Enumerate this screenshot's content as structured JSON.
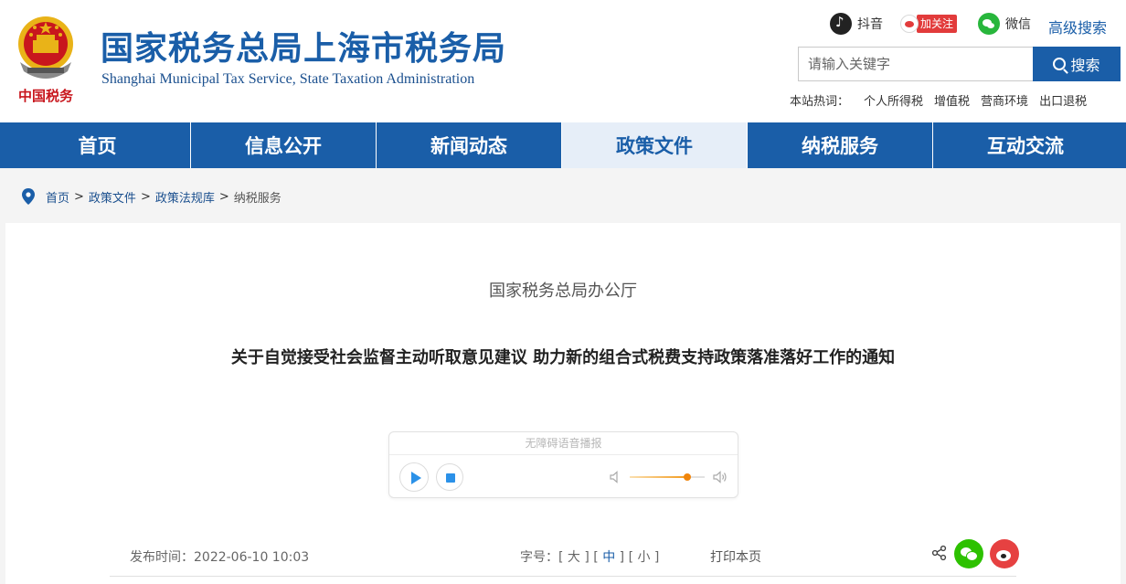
{
  "header": {
    "emblem_text": "中国税务",
    "title": "国家税务总局上海市税务局",
    "subtitle": "Shanghai Municipal Tax Service, State Taxation Administration",
    "social": {
      "douyin": "抖音",
      "weibo_follow": "加关注",
      "wechat": "微信"
    },
    "advanced_search": "高级搜索",
    "search": {
      "placeholder": "请输入关键字",
      "button": "搜索"
    },
    "hotwords": {
      "label": "本站热词：",
      "items": [
        "个人所得税",
        "增值税",
        "营商环境",
        "出口退税"
      ]
    }
  },
  "nav": {
    "items": [
      "首页",
      "信息公开",
      "新闻动态",
      "政策文件",
      "纳税服务",
      "互动交流"
    ],
    "active": "政策文件"
  },
  "breadcrumb": {
    "items": [
      "首页",
      "政策文件",
      "政策法规库"
    ],
    "current": "纳税服务",
    "separator": ">"
  },
  "article": {
    "issuer": "国家税务总局办公厅",
    "title": "关于自觉接受社会监督主动听取意见建议 助力新的组合式税费支持政策落准落好工作的通知",
    "player": {
      "title": "无障碍语音播报",
      "volume": 0.77
    },
    "publish_label": "发布时间：",
    "publish_date": "2022-06-10 10:03",
    "font_size_label": "字号：",
    "font_sizes": [
      "大",
      "中",
      "小"
    ],
    "font_size_selected": "中",
    "print": "打印本页"
  },
  "colors": {
    "primary": "#1a5ea8",
    "nav_active_bg": "#e6eef8",
    "weibo_red": "#e23b3b",
    "wechat_green": "#28b63c",
    "emblem_red": "#c8161d",
    "emblem_gold": "#e9b318",
    "volume_accent": "#f0850b"
  }
}
